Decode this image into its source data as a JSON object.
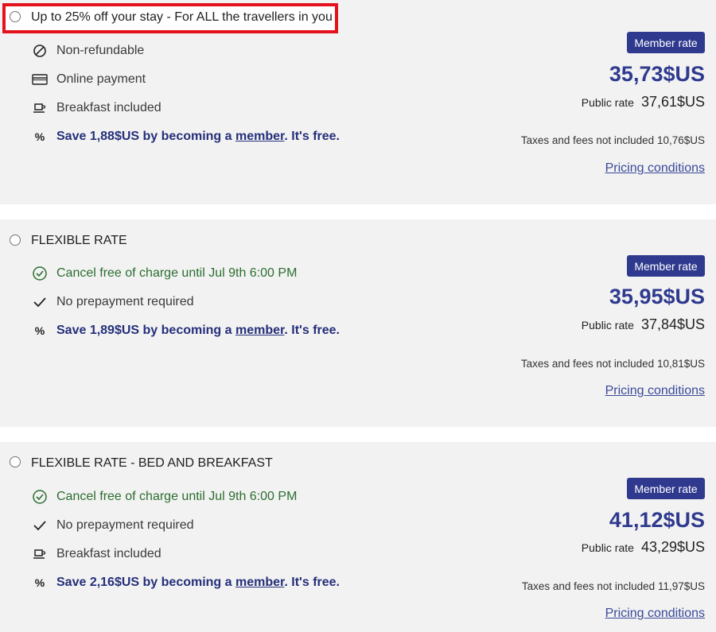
{
  "rates": [
    {
      "title": "Up to 25% off your stay - For ALL the travellers in you",
      "highlighted": true,
      "features": [
        {
          "icon": "no-entry-icon",
          "text": "Non-refundable",
          "style": "normal"
        },
        {
          "icon": "credit-card-icon",
          "text": "Online payment",
          "style": "normal"
        },
        {
          "icon": "coffee-cup-icon",
          "text": "Breakfast included",
          "style": "normal"
        }
      ],
      "save": {
        "icon_text": "%",
        "prefix": "Save 1,88$US by becoming a ",
        "link": "member",
        "suffix": ". It's free."
      },
      "badge": "Member rate",
      "price": "35,73$US",
      "public_label": "Public rate",
      "public_price": "37,61$US",
      "taxes_label": "Taxes and fees not included",
      "taxes_value": "10,76$US",
      "pricing_conditions": "Pricing conditions"
    },
    {
      "title": "FLEXIBLE RATE",
      "highlighted": false,
      "features": [
        {
          "icon": "check-circle-icon",
          "text": "Cancel free of charge until Jul 9th 6:00 PM",
          "style": "green"
        },
        {
          "icon": "checkmark-icon",
          "text": "No prepayment required",
          "style": "normal"
        }
      ],
      "save": {
        "icon_text": "%",
        "prefix": "Save 1,89$US by becoming a ",
        "link": "member",
        "suffix": ". It's free."
      },
      "badge": "Member rate",
      "price": "35,95$US",
      "public_label": "Public rate",
      "public_price": "37,84$US",
      "taxes_label": "Taxes and fees not included",
      "taxes_value": "10,81$US",
      "pricing_conditions": "Pricing conditions"
    },
    {
      "title": "FLEXIBLE RATE - BED AND BREAKFAST",
      "highlighted": false,
      "features": [
        {
          "icon": "check-circle-icon",
          "text": "Cancel free of charge until Jul 9th 6:00 PM",
          "style": "green"
        },
        {
          "icon": "checkmark-icon",
          "text": "No prepayment required",
          "style": "normal"
        },
        {
          "icon": "coffee-cup-icon",
          "text": "Breakfast included",
          "style": "normal"
        }
      ],
      "save": {
        "icon_text": "%",
        "prefix": "Save 2,16$US by becoming a ",
        "link": "member",
        "suffix": ". It's free."
      },
      "badge": "Member rate",
      "price": "41,12$US",
      "public_label": "Public rate",
      "public_price": "43,29$US",
      "taxes_label": "Taxes and fees not included",
      "taxes_value": "11,97$US",
      "pricing_conditions": "Pricing conditions"
    }
  ],
  "colors": {
    "brand": "#2f3a8f",
    "highlight_border": "#e4121c",
    "cancel_green": "#2b6e2f",
    "card_bg": "#f2f2f2"
  }
}
